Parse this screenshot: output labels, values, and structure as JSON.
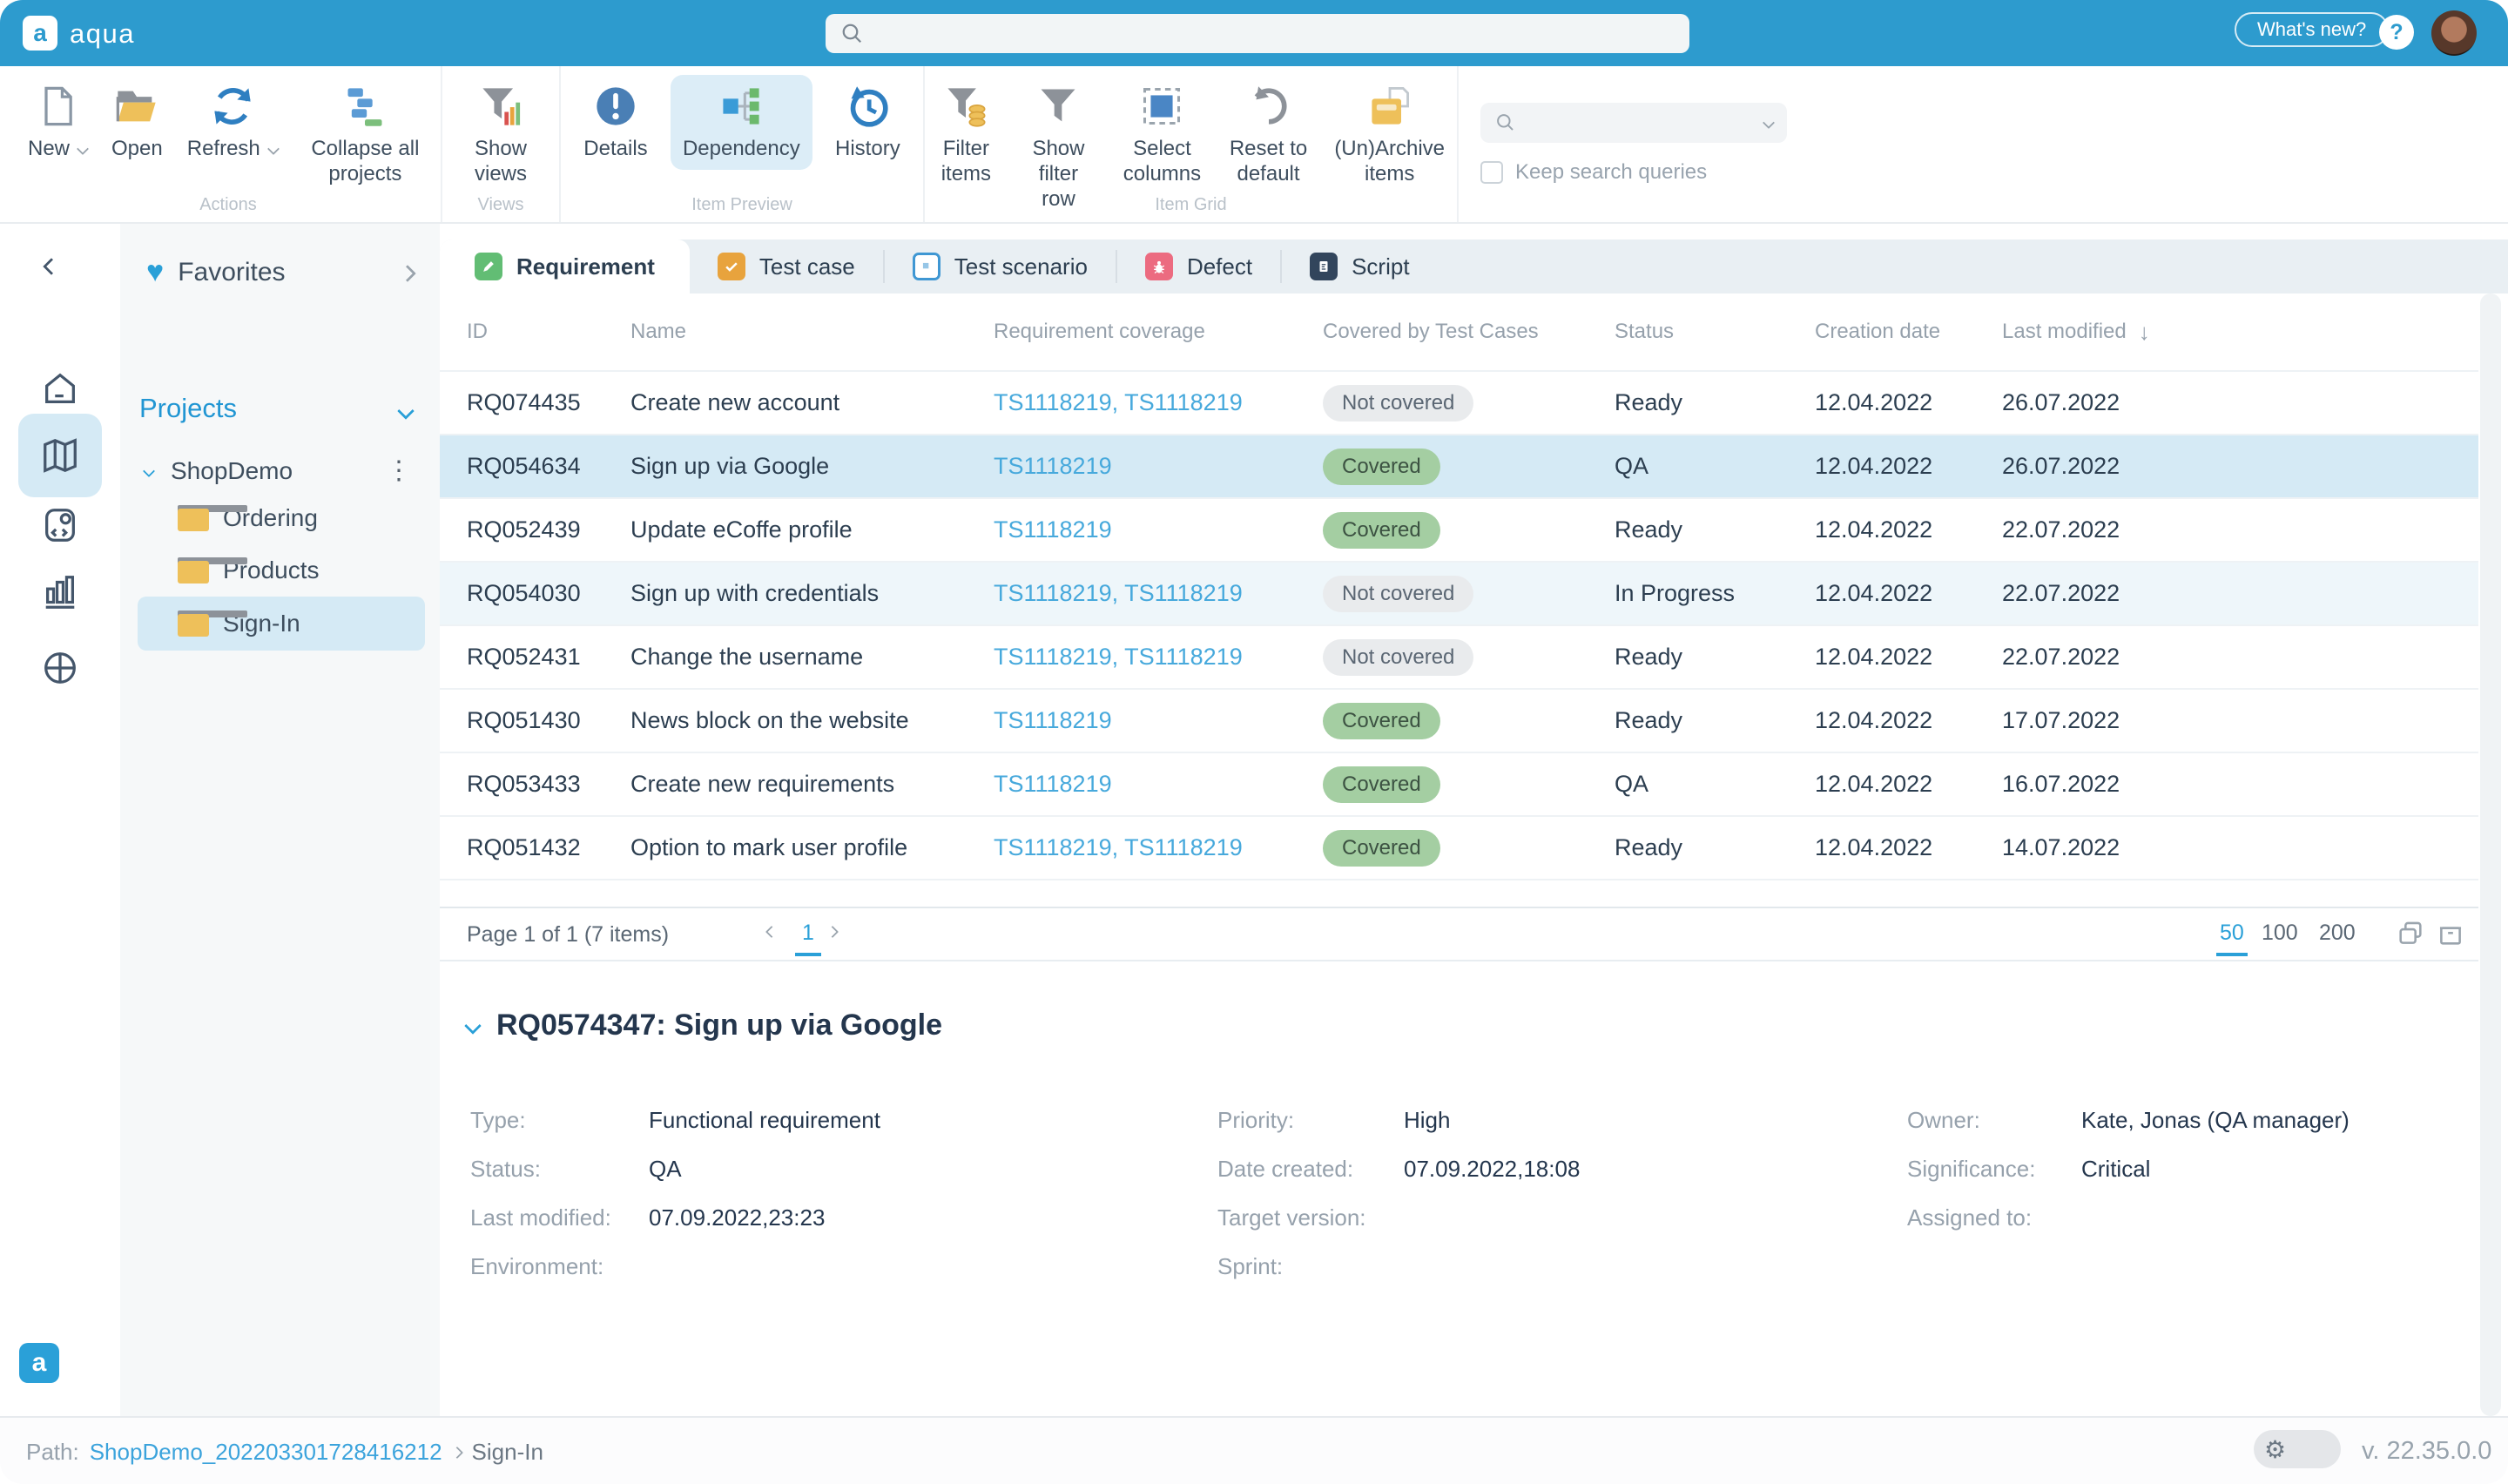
{
  "topbar": {
    "brand": "aqua",
    "whats_new": "What's new?"
  },
  "icons": {
    "help": "?",
    "heart": "♥",
    "kebab": "⋮",
    "sort_desc": "↓",
    "gear": "⚙"
  },
  "colors": {
    "topbar": "#2d9bce",
    "accent": "#2aa0d8",
    "covered_badge": "#a4cea2",
    "not_covered_badge": "#e9ebed",
    "selected_row": "#d5eaf5"
  },
  "ribbon": {
    "group_labels": {
      "actions": "Actions",
      "views": "Views",
      "item_preview": "Item Preview",
      "item_grid": "Item Grid"
    },
    "buttons": {
      "new": "New",
      "open": "Open",
      "refresh": "Refresh",
      "collapse": "Collapse all projects",
      "show_views": "Show views",
      "details": "Details",
      "dependency": "Dependency",
      "history": "History",
      "filter_items": "Filter items",
      "show_filter_row": "Show filter row",
      "select_columns": "Select columns",
      "reset": "Reset to default",
      "unarchive": "(Un)Archive items"
    },
    "keep_search": "Keep search queries"
  },
  "sidebar": {
    "favorites": "Favorites",
    "projects_title": "Projects",
    "project": "ShopDemo",
    "folders": [
      "Ordering",
      "Products",
      "Sign-In"
    ]
  },
  "tabs": [
    "Requirement",
    "Test case",
    "Test scenario",
    "Defect",
    "Script"
  ],
  "table": {
    "columns": {
      "id": "ID",
      "name": "Name",
      "coverage": "Requirement coverage",
      "covered": "Covered by Test Cases",
      "status": "Status",
      "created": "Creation date",
      "modified": "Last modified"
    },
    "rows": [
      {
        "id": "RQ074435",
        "name": "Create new account",
        "coverage": "TS1118219, TS1118219",
        "covered": "Not covered",
        "status": "Ready",
        "created": "12.04.2022",
        "modified": "26.07.2022"
      },
      {
        "id": "RQ054634",
        "name": "Sign up via Google",
        "coverage": "TS1118219",
        "covered": "Covered",
        "status": "QA",
        "created": "12.04.2022",
        "modified": "26.07.2022"
      },
      {
        "id": "RQ052439",
        "name": "Update eCoffe profile",
        "coverage": "TS1118219",
        "covered": "Covered",
        "status": "Ready",
        "created": "12.04.2022",
        "modified": "22.07.2022"
      },
      {
        "id": "RQ054030",
        "name": "Sign up with credentials",
        "coverage": "TS1118219, TS1118219",
        "covered": "Not covered",
        "status": "In Progress",
        "created": "12.04.2022",
        "modified": "22.07.2022"
      },
      {
        "id": "RQ052431",
        "name": "Change the username",
        "coverage": "TS1118219, TS1118219",
        "covered": "Not covered",
        "status": "Ready",
        "created": "12.04.2022",
        "modified": "22.07.2022"
      },
      {
        "id": "RQ051430",
        "name": "News block on the website",
        "coverage": "TS1118219",
        "covered": "Covered",
        "status": "Ready",
        "created": "12.04.2022",
        "modified": "17.07.2022"
      },
      {
        "id": "RQ053433",
        "name": "Create new requirements",
        "coverage": "TS1118219",
        "covered": "Covered",
        "status": "QA",
        "created": "12.04.2022",
        "modified": "16.07.2022"
      },
      {
        "id": "RQ051432",
        "name": "Option to mark user profile",
        "coverage": "TS1118219, TS1118219",
        "covered": "Covered",
        "status": "Ready",
        "created": "12.04.2022",
        "modified": "14.07.2022"
      }
    ]
  },
  "pagination": {
    "summary": "Page 1 of 1 (7 items)",
    "page": "1",
    "sizes": [
      "50",
      "100",
      "200"
    ]
  },
  "detail": {
    "title": "RQ0574347: Sign up via Google",
    "col1": [
      {
        "label": "Type:",
        "value": "Functional requirement"
      },
      {
        "label": "Status:",
        "value": "QA"
      },
      {
        "label": "Last modified:",
        "value": "07.09.2022,23:23"
      },
      {
        "label": "Environment:",
        "value": ""
      }
    ],
    "col2": [
      {
        "label": "Priority:",
        "value": "High"
      },
      {
        "label": "Date created:",
        "value": "07.09.2022,18:08"
      },
      {
        "label": "Target version:",
        "value": ""
      },
      {
        "label": "Sprint:",
        "value": ""
      }
    ],
    "col3": [
      {
        "label": "Owner:",
        "value": "Kate, Jonas (QA manager)"
      },
      {
        "label": "Significance:",
        "value": "Critical"
      },
      {
        "label": "Assigned to:",
        "value": ""
      }
    ]
  },
  "statusbar": {
    "path_label": "Path:",
    "project": "ShopDemo_202203301728416212",
    "current": "Sign-In",
    "version": "v. 22.35.0.0"
  }
}
